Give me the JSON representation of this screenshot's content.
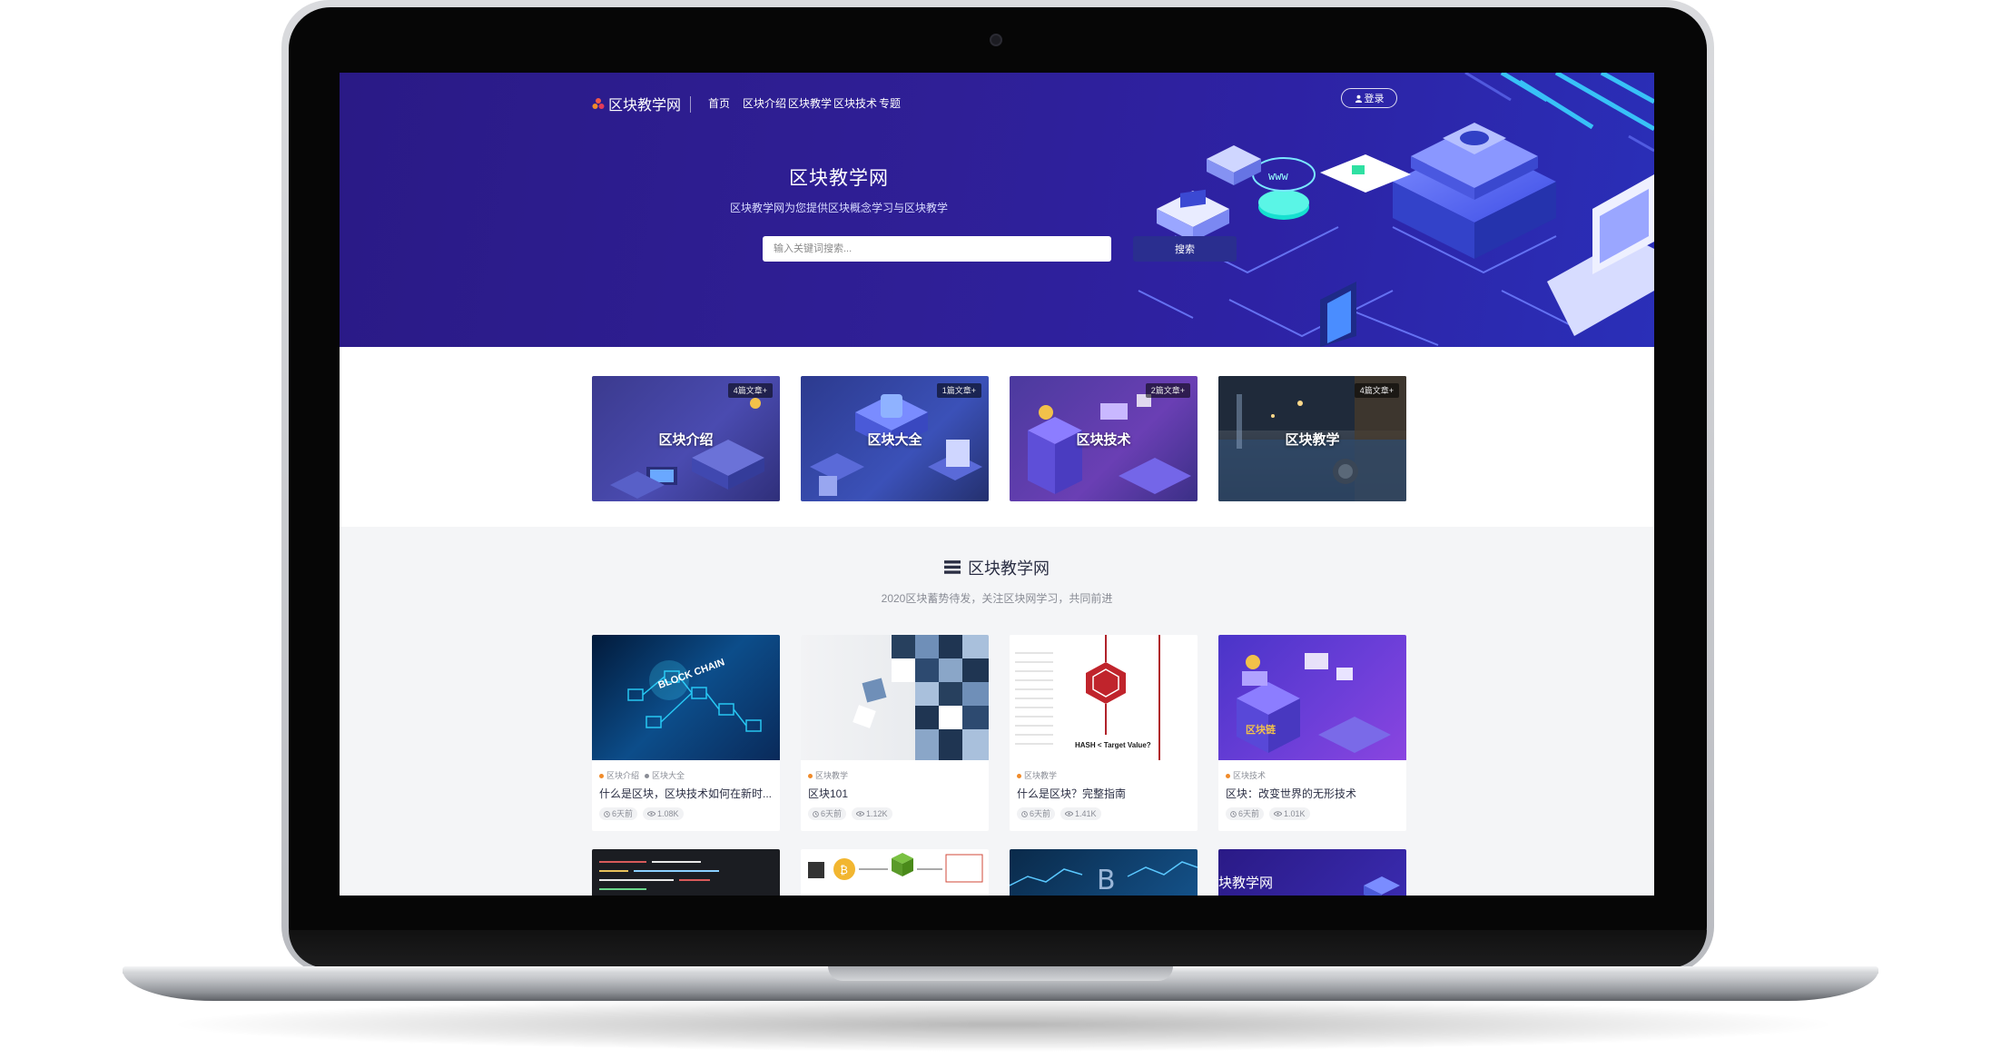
{
  "brand": {
    "name": "区块教学网"
  },
  "nav": {
    "items": [
      "首页",
      "区块介绍",
      "区块教学",
      "区块技术",
      "专题"
    ]
  },
  "user": {
    "login_label": "登录"
  },
  "hero": {
    "title": "区块教学网",
    "subtitle": "区块教学网为您提供区块概念学习与区块教学",
    "search_placeholder": "输入关键词搜索...",
    "search_button": "搜索"
  },
  "categories": [
    {
      "name": "区块介绍",
      "badge": "4篇文章+",
      "icon": "isometric-blockchain-illustration"
    },
    {
      "name": "区块大全",
      "badge": "1篇文章+",
      "icon": "isometric-lock-illustration"
    },
    {
      "name": "区块技术",
      "badge": "2篇文章+",
      "icon": "isometric-server-illustration"
    },
    {
      "name": "区块教学",
      "badge": "4篇文章+",
      "icon": "night-street-photo"
    }
  ],
  "section": {
    "title": "区块教学网",
    "subtitle": "2020区块蓄势待发，关注区块网学习，共同前进",
    "icon": "stack-icon"
  },
  "posts": [
    {
      "tags": [
        "区块介绍",
        "区块大全"
      ],
      "title": "什么是区块，区块技术如何在新时...",
      "time": "6天前",
      "views": "1.08K",
      "thumb_text": "BLOCK CHAIN"
    },
    {
      "tags": [
        "区块教学"
      ],
      "title": "区块101",
      "time": "6天前",
      "views": "1.12K",
      "thumb_text": ""
    },
    {
      "tags": [
        "区块教学"
      ],
      "title": "什么是区块？完整指南",
      "time": "6天前",
      "views": "1.41K",
      "thumb_text": "HASH < Target Value?"
    },
    {
      "tags": [
        "区块技术"
      ],
      "title": "区块：改变世界的无形技术",
      "time": "6天前",
      "views": "1.01K",
      "thumb_text": "区块链"
    }
  ],
  "row2": {
    "item4_text": "块教学网"
  },
  "colors": {
    "hero_bg": "#2d1f96",
    "accent": "#f08b2a",
    "button": "#2a2e8f"
  }
}
